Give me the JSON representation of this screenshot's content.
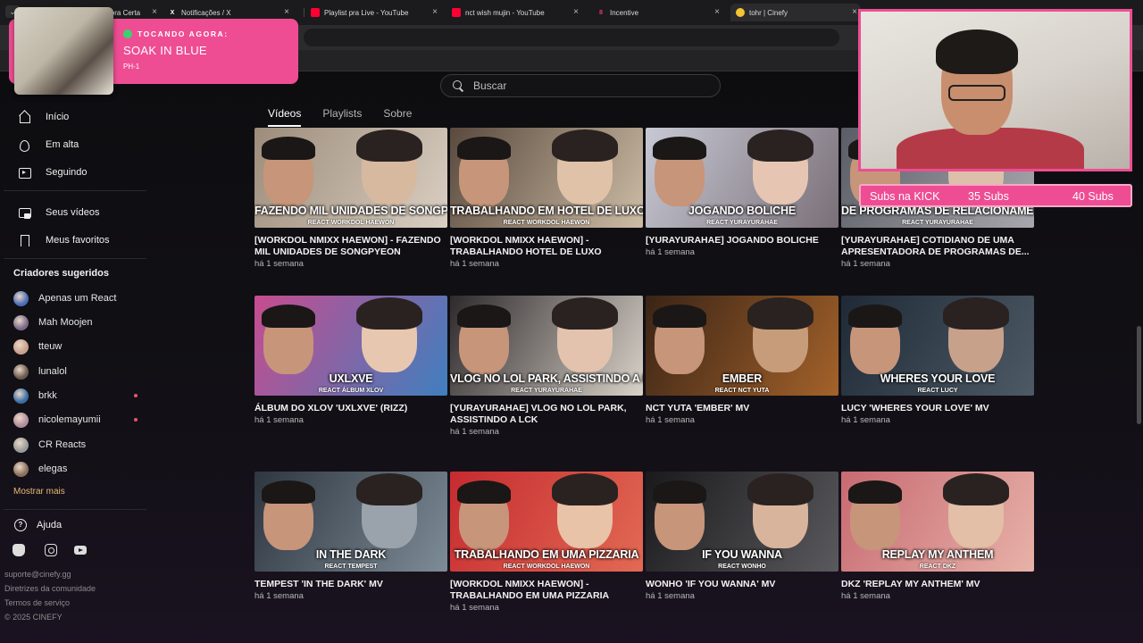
{
  "browser": {
    "tabs": [
      {
        "label": "Hora Certa",
        "fav_color": "#2d8cff",
        "fav": ""
      },
      {
        "label": "Notificações / X",
        "fav_color": "#000000",
        "fav": "X"
      },
      {
        "label": "Playlist pra Live - YouTube",
        "fav_color": "#ff0033",
        "fav": ""
      },
      {
        "label": "nct wish mujin - YouTube",
        "fav_color": "#ff0033",
        "fav": ""
      },
      {
        "label": "Incentive",
        "fav_color": "#e23b6b",
        "fav": "8"
      },
      {
        "label": "tohr | Cinefy",
        "fav_color": "#f5c431",
        "fav": ""
      }
    ]
  },
  "search": {
    "placeholder": "Buscar"
  },
  "tabs": [
    "Vídeos",
    "Playlists",
    "Sobre"
  ],
  "nav": {
    "home": "Início",
    "trending": "Em alta",
    "following": "Seguindo",
    "my_videos": "Seus vídeos",
    "favorites": "Meus favoritos"
  },
  "creators_title": "Criadores sugeridos",
  "creators": [
    {
      "name": "Apenas um React",
      "color": "#4b6cb7",
      "live": false
    },
    {
      "name": "Mah Moojen",
      "color": "#7a6a8a",
      "live": false
    },
    {
      "name": "tteuw",
      "color": "#c9a08a",
      "live": false
    },
    {
      "name": "lunalol",
      "color": "#6d5a4f",
      "live": false
    },
    {
      "name": "brkk",
      "color": "#3a6ea5",
      "live": true
    },
    {
      "name": "nicolemayumii",
      "color": "#b28c9b",
      "live": true
    },
    {
      "name": "CR Reacts",
      "color": "#9a9a9a",
      "live": false
    },
    {
      "name": "elegas",
      "color": "#8a6f5a",
      "live": false
    }
  ],
  "more_label": "Mostrar mais",
  "help_label": "Ajuda",
  "footer": {
    "email": "suporte@cinefy.gg",
    "guidelines": "Diretrizes da comunidade",
    "terms": "Termos de serviço",
    "copyright": "© 2025 CINEFY"
  },
  "videos": [
    {
      "thumb_title": "FAZENDO MIL UNIDADES DE SONGPYEON",
      "thumb_sub": "REACT WORKDOL HAEWON",
      "title": "[WORKDOL NMIXX HAEWON] - FAZENDO MIL UNIDADES DE SONGPYEON",
      "meta": "há 1 semana",
      "bg": [
        "#9d8c7a",
        "#d9cfc2"
      ],
      "face2": "#d7b9a0"
    },
    {
      "thumb_title": "TRABALHANDO EM HOTEL DE LUXO",
      "thumb_sub": "REACT WORKDOL HAEWON",
      "title": "[WORKDOL NMIXX HAEWON] - TRABALHANDO HOTEL DE LUXO",
      "meta": "há 1 semana",
      "bg": [
        "#5a4a3e",
        "#cdbca5"
      ],
      "face2": "#e0c2a8"
    },
    {
      "thumb_title": "JOGANDO BOLICHE",
      "thumb_sub": "REACT YURAYURAHAE",
      "title": "[YURAYURAHAE] JOGANDO BOLICHE",
      "meta": "há 1 semana",
      "bg": [
        "#c7c9d4",
        "#7a6f78"
      ],
      "face2": "#e6c6b3"
    },
    {
      "thumb_title": "DE PROGRAMAS DE RELACIONAMENTO",
      "thumb_sub": "REACT YURAYURAHAE",
      "title": "[YURAYURAHAE] COTIDIANO DE UMA APRESENTADORA DE PROGRAMAS DE...",
      "meta": "há 1 semana",
      "bg": [
        "#5a5d66",
        "#a9a7ad"
      ],
      "face2": "#dcc0aa"
    },
    {
      "thumb_title": "UXLXVE",
      "thumb_sub": "REACT ÁLBUM XLOV",
      "title": "ÁLBUM DO XLOV 'UXLXVE' (RIZZ)",
      "meta": "há 1 semana",
      "bg": [
        "#c74c8e",
        "#3f7fbf"
      ],
      "face2": "#e8c7b1"
    },
    {
      "thumb_title": "VLOG NO LOL PARK, ASSISTINDO A LCK",
      "thumb_sub": "REACT YURAYURAHAE",
      "title": "[YURAYURAHAE] VLOG NO LOL PARK, ASSISTINDO A LCK",
      "meta": "há 1 semana",
      "bg": [
        "#2e2a2c",
        "#d9d2c9"
      ],
      "face2": "#e3c3ad"
    },
    {
      "thumb_title": "EMBER",
      "thumb_sub": "REACT NCT YUTA",
      "title": "NCT YUTA 'EMBER' MV",
      "meta": "há 1 semana",
      "bg": [
        "#3a2416",
        "#a4622a"
      ],
      "face2": "#c79c7b"
    },
    {
      "thumb_title": "WHERES YOUR LOVE",
      "thumb_sub": "REACT LUCY",
      "title": "LUCY 'WHERES YOUR LOVE' MV",
      "meta": "há 1 semana",
      "bg": [
        "#1f2a36",
        "#4d5a66"
      ],
      "face2": "#c7a18a"
    },
    {
      "thumb_title": "IN THE DARK",
      "thumb_sub": "REACT TEMPEST",
      "title": "TEMPEST 'IN THE DARK' MV",
      "meta": "há 1 semana",
      "bg": [
        "#2e3640",
        "#7e8c97"
      ],
      "face2": "#9aa3ab"
    },
    {
      "thumb_title": "TRABALHANDO EM UMA PIZZARIA",
      "thumb_sub": "REACT WORKDOL HAEWON",
      "title": "[WORKDOL NMIXX HAEWON] - TRABALHANDO EM UMA PIZZARIA",
      "meta": "há 1 semana",
      "bg": [
        "#c62b30",
        "#e26a54"
      ],
      "face2": "#e8c3a8"
    },
    {
      "thumb_title": "IF YOU WANNA",
      "thumb_sub": "REACT WONHO",
      "title": "WONHO 'IF YOU WANNA' MV",
      "meta": "há 1 semana",
      "bg": [
        "#1a1a1c",
        "#5a5a5e"
      ],
      "face2": "#d9b49c"
    },
    {
      "thumb_title": "REPLAY MY ANTHEM",
      "thumb_sub": "REACT DKZ",
      "title": "DKZ 'REPLAY MY ANTHEM' MV",
      "meta": "há 1 semana",
      "bg": [
        "#c86a72",
        "#e7b2a8"
      ],
      "face2": "#e2bfa6"
    }
  ],
  "now_playing": {
    "label": "TOCANDO AGORA:",
    "song": "SOAK IN BLUE",
    "artist": "PH-1"
  },
  "subs": {
    "kick": "Subs na KICK",
    "count": "35 Subs",
    "goal": "40 Subs"
  }
}
